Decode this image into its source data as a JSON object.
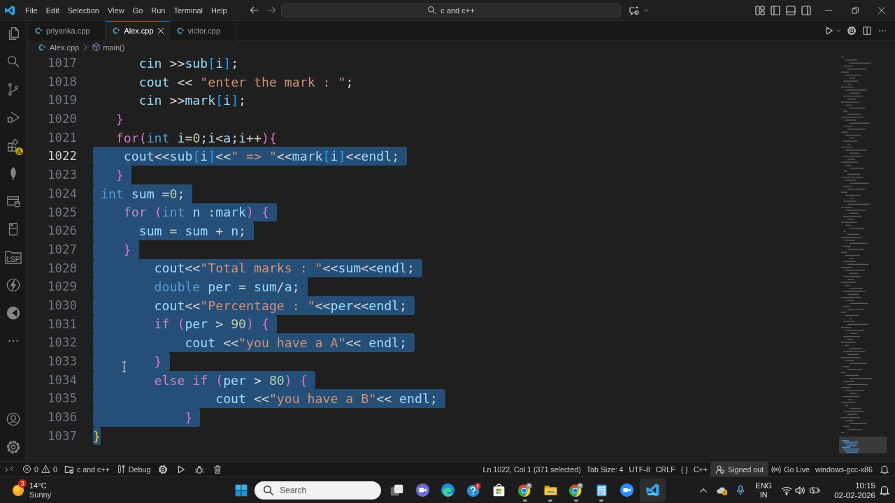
{
  "title_bar": {
    "menu": [
      "File",
      "Edit",
      "Selection",
      "View",
      "Go",
      "Run",
      "Terminal",
      "Help"
    ],
    "command_center": "c and c++"
  },
  "activity_bar": {
    "folder_label": "LSP"
  },
  "tabs": [
    {
      "label": "priyanka.cpp",
      "selected": false
    },
    {
      "label": "Alex.cpp",
      "selected": true
    },
    {
      "label": "victor.cpp",
      "selected": false
    }
  ],
  "breadcrumbs": [
    {
      "label": "Alex.cpp",
      "kind": "file"
    },
    {
      "label": "main()",
      "kind": "function"
    }
  ],
  "editor": {
    "lines": [
      {
        "number": "1017",
        "selected": false,
        "current": false,
        "tokens": [
          {
            "text": "      cin",
            "kind": "variable"
          },
          {
            "text": " >>",
            "kind": "operator"
          },
          {
            "text": "sub",
            "kind": "variable"
          },
          {
            "text": "[",
            "kind": "bracket3"
          },
          {
            "text": "i",
            "kind": "variable"
          },
          {
            "text": "]",
            "kind": "bracket3"
          },
          {
            "text": ";",
            "kind": "operator"
          }
        ]
      },
      {
        "number": "1018",
        "selected": false,
        "current": false,
        "tokens": [
          {
            "text": "      cout",
            "kind": "variable"
          },
          {
            "text": " << ",
            "kind": "operator"
          },
          {
            "text": "\"enter the mark : \"",
            "kind": "string"
          },
          {
            "text": ";",
            "kind": "operator"
          }
        ]
      },
      {
        "number": "1019",
        "selected": false,
        "current": false,
        "tokens": [
          {
            "text": "      cin",
            "kind": "variable"
          },
          {
            "text": " >>",
            "kind": "operator"
          },
          {
            "text": "mark",
            "kind": "variable"
          },
          {
            "text": "[",
            "kind": "bracket3"
          },
          {
            "text": "i",
            "kind": "variable"
          },
          {
            "text": "]",
            "kind": "bracket3"
          },
          {
            "text": ";",
            "kind": "operator"
          }
        ]
      },
      {
        "number": "1020",
        "selected": false,
        "current": false,
        "tokens": [
          {
            "text": "   }",
            "kind": "bracket2"
          }
        ]
      },
      {
        "number": "1021",
        "selected": false,
        "current": false,
        "tokens": [
          {
            "text": "   for",
            "kind": "control"
          },
          {
            "text": "(",
            "kind": "bracket2"
          },
          {
            "text": "int ",
            "kind": "keyword"
          },
          {
            "text": "i",
            "kind": "variable"
          },
          {
            "text": "=",
            "kind": "operator"
          },
          {
            "text": "0",
            "kind": "number"
          },
          {
            "text": ";",
            "kind": "operator"
          },
          {
            "text": "i",
            "kind": "variable"
          },
          {
            "text": "<",
            "kind": "operator"
          },
          {
            "text": "a",
            "kind": "variable"
          },
          {
            "text": ";",
            "kind": "operator"
          },
          {
            "text": "i",
            "kind": "variable"
          },
          {
            "text": "++",
            "kind": "operator"
          },
          {
            "text": ")",
            "kind": "bracket2"
          },
          {
            "text": "{",
            "kind": "bracket2"
          }
        ]
      },
      {
        "number": "1022",
        "selected": true,
        "current": true,
        "tokens": [
          {
            "text": "    cout",
            "kind": "variable"
          },
          {
            "text": "<<",
            "kind": "operator"
          },
          {
            "text": "sub",
            "kind": "variable"
          },
          {
            "text": "[",
            "kind": "bracket3"
          },
          {
            "text": "i",
            "kind": "variable"
          },
          {
            "text": "]",
            "kind": "bracket3"
          },
          {
            "text": "<<",
            "kind": "operator"
          },
          {
            "text": "\" => \"",
            "kind": "string"
          },
          {
            "text": "<<",
            "kind": "operator"
          },
          {
            "text": "mark",
            "kind": "variable"
          },
          {
            "text": "[",
            "kind": "bracket3"
          },
          {
            "text": "i",
            "kind": "variable"
          },
          {
            "text": "]",
            "kind": "bracket3"
          },
          {
            "text": "<<",
            "kind": "operator"
          },
          {
            "text": "endl",
            "kind": "variable"
          },
          {
            "text": ";",
            "kind": "operator"
          }
        ]
      },
      {
        "number": "1023",
        "selected": true,
        "current": false,
        "tokens": [
          {
            "text": "   }",
            "kind": "bracket2"
          }
        ]
      },
      {
        "number": "1024",
        "selected": true,
        "current": false,
        "tokens": [
          {
            "text": " int ",
            "kind": "keyword"
          },
          {
            "text": "sum",
            "kind": "variable"
          },
          {
            "text": " =",
            "kind": "operator"
          },
          {
            "text": "0",
            "kind": "number"
          },
          {
            "text": ";",
            "kind": "operator"
          }
        ]
      },
      {
        "number": "1025",
        "selected": true,
        "current": false,
        "tokens": [
          {
            "text": "    for ",
            "kind": "control"
          },
          {
            "text": "(",
            "kind": "bracket2"
          },
          {
            "text": "int ",
            "kind": "keyword"
          },
          {
            "text": "n",
            "kind": "variable"
          },
          {
            "text": " :",
            "kind": "operator"
          },
          {
            "text": "mark",
            "kind": "variable"
          },
          {
            "text": ")",
            "kind": "bracket2"
          },
          {
            "text": " {",
            "kind": "bracket2"
          }
        ]
      },
      {
        "number": "1026",
        "selected": true,
        "current": false,
        "tokens": [
          {
            "text": "      sum",
            "kind": "variable"
          },
          {
            "text": " = ",
            "kind": "operator"
          },
          {
            "text": "sum",
            "kind": "variable"
          },
          {
            "text": " + ",
            "kind": "operator"
          },
          {
            "text": "n",
            "kind": "variable"
          },
          {
            "text": ";",
            "kind": "operator"
          }
        ]
      },
      {
        "number": "1027",
        "selected": true,
        "current": false,
        "tokens": [
          {
            "text": "    }",
            "kind": "bracket2"
          }
        ]
      },
      {
        "number": "1028",
        "selected": true,
        "current": false,
        "tokens": [
          {
            "text": "        cout",
            "kind": "variable"
          },
          {
            "text": "<<",
            "kind": "operator"
          },
          {
            "text": "\"Total marks : \"",
            "kind": "string"
          },
          {
            "text": "<<",
            "kind": "operator"
          },
          {
            "text": "sum",
            "kind": "variable"
          },
          {
            "text": "<<",
            "kind": "operator"
          },
          {
            "text": "endl",
            "kind": "variable"
          },
          {
            "text": ";",
            "kind": "operator"
          }
        ]
      },
      {
        "number": "1029",
        "selected": true,
        "current": false,
        "tokens": [
          {
            "text": "        double ",
            "kind": "keyword"
          },
          {
            "text": "per",
            "kind": "variable"
          },
          {
            "text": " = ",
            "kind": "operator"
          },
          {
            "text": "sum",
            "kind": "variable"
          },
          {
            "text": "/",
            "kind": "operator"
          },
          {
            "text": "a",
            "kind": "variable"
          },
          {
            "text": ";",
            "kind": "operator"
          }
        ]
      },
      {
        "number": "1030",
        "selected": true,
        "current": false,
        "tokens": [
          {
            "text": "        cout",
            "kind": "variable"
          },
          {
            "text": "<<",
            "kind": "operator"
          },
          {
            "text": "\"Percentage : \"",
            "kind": "string"
          },
          {
            "text": "<<",
            "kind": "operator"
          },
          {
            "text": "per",
            "kind": "variable"
          },
          {
            "text": "<<",
            "kind": "operator"
          },
          {
            "text": "endl",
            "kind": "variable"
          },
          {
            "text": ";",
            "kind": "operator"
          }
        ]
      },
      {
        "number": "1031",
        "selected": true,
        "current": false,
        "tokens": [
          {
            "text": "        if ",
            "kind": "control"
          },
          {
            "text": "(",
            "kind": "bracket2"
          },
          {
            "text": "per",
            "kind": "variable"
          },
          {
            "text": " > ",
            "kind": "operator"
          },
          {
            "text": "90",
            "kind": "number"
          },
          {
            "text": ")",
            "kind": "bracket2"
          },
          {
            "text": " {",
            "kind": "bracket2"
          }
        ]
      },
      {
        "number": "1032",
        "selected": true,
        "current": false,
        "tokens": [
          {
            "text": "            cout",
            "kind": "variable"
          },
          {
            "text": " <<",
            "kind": "operator"
          },
          {
            "text": "\"you have a A\"",
            "kind": "string"
          },
          {
            "text": "<< ",
            "kind": "operator"
          },
          {
            "text": "endl",
            "kind": "variable"
          },
          {
            "text": ";",
            "kind": "operator"
          }
        ]
      },
      {
        "number": "1033",
        "selected": true,
        "current": false,
        "tokens": [
          {
            "text": "        }",
            "kind": "bracket2"
          }
        ]
      },
      {
        "number": "1034",
        "selected": true,
        "current": false,
        "tokens": [
          {
            "text": "        else if ",
            "kind": "control"
          },
          {
            "text": "(",
            "kind": "bracket2"
          },
          {
            "text": "per",
            "kind": "variable"
          },
          {
            "text": " > ",
            "kind": "operator"
          },
          {
            "text": "80",
            "kind": "number"
          },
          {
            "text": ")",
            "kind": "bracket2"
          },
          {
            "text": " {",
            "kind": "bracket2"
          }
        ]
      },
      {
        "number": "1035",
        "selected": true,
        "current": false,
        "tokens": [
          {
            "text": "                cout",
            "kind": "variable"
          },
          {
            "text": " <<",
            "kind": "operator"
          },
          {
            "text": "\"you have a B\"",
            "kind": "string"
          },
          {
            "text": "<< ",
            "kind": "operator"
          },
          {
            "text": "endl",
            "kind": "variable"
          },
          {
            "text": ";",
            "kind": "operator"
          }
        ]
      },
      {
        "number": "1036",
        "selected": true,
        "current": false,
        "tokens": [
          {
            "text": "            }",
            "kind": "bracket2"
          }
        ]
      },
      {
        "number": "1037",
        "selected": true,
        "current": false,
        "tokens": [
          {
            "text": "}",
            "kind": "bracket1"
          }
        ]
      }
    ]
  },
  "status_bar": {
    "problems": {
      "errors": "0",
      "warnings": "0"
    },
    "project": "c and c++",
    "debug_config": "Debug",
    "cursor": "Ln 1022, Col 1 (371 selected)",
    "tab_size": "Tab Size: 4",
    "encoding": "UTF-8",
    "line_ending": "CRLF",
    "language": {
      "icon": "{ }",
      "label": "C++"
    },
    "account": {
      "label": "Signed out",
      "hovered": true
    },
    "live_server": "Go Live",
    "configuration": "windows-gcc-x86"
  },
  "taskbar": {
    "weather": {
      "badge": "3",
      "temperature": "14°C",
      "condition": "Sunny"
    },
    "search": {
      "placeholder": "Search"
    },
    "apps": [
      {
        "kind": "stack",
        "running": false,
        "active": false
      },
      {
        "kind": "camera",
        "running": false,
        "active": false
      },
      {
        "kind": "wave",
        "running": false,
        "active": false
      },
      {
        "kind": "help",
        "running": false,
        "active": false
      },
      {
        "kind": "store",
        "running": false,
        "active": false
      },
      {
        "kind": "browser",
        "running": true,
        "active": false
      },
      {
        "kind": "folder",
        "running": true,
        "active": false
      },
      {
        "kind": "browser",
        "running": true,
        "active": false
      },
      {
        "kind": "notes",
        "running": true,
        "active": false
      },
      {
        "kind": "meeting",
        "running": false,
        "active": false
      },
      {
        "kind": "editor",
        "running": true,
        "active": true
      }
    ],
    "input_language": [
      "ENG",
      "IN"
    ],
    "clock": {
      "time": "10:15",
      "date": "02-02-2026"
    }
  }
}
